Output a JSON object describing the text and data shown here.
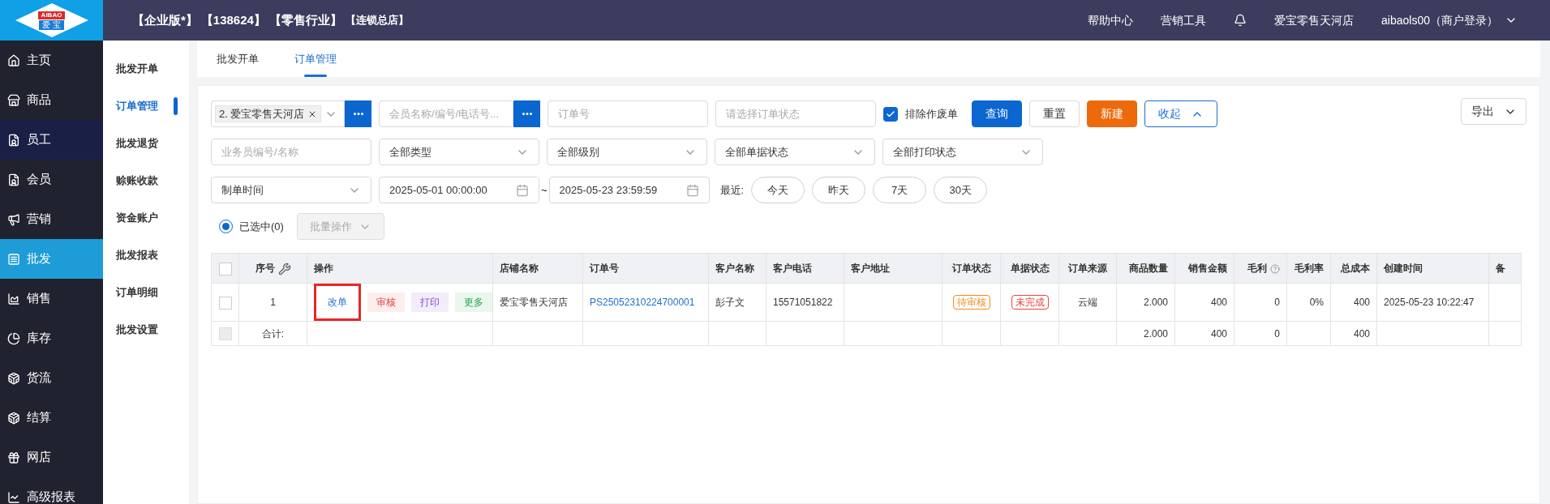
{
  "header": {
    "logo_top": "AIBAO",
    "logo_bottom": "爱 宝",
    "edition": "【企业版*】",
    "account_no": "【138624】",
    "industry": "【零售行业】",
    "store_type": "【连锁总店】",
    "links": [
      "帮助中心",
      "营销工具"
    ],
    "store": "爱宝零售天河店",
    "user": "aibaols00（商户登录）"
  },
  "sidebar": {
    "items": [
      {
        "label": "主页",
        "selected": false,
        "hovered": false
      },
      {
        "label": "商品",
        "selected": false,
        "hovered": false
      },
      {
        "label": "员工",
        "selected": false,
        "hovered": true
      },
      {
        "label": "会员",
        "selected": false,
        "hovered": false
      },
      {
        "label": "营销",
        "selected": false,
        "hovered": false
      },
      {
        "label": "批发",
        "selected": true,
        "hovered": false
      },
      {
        "label": "销售",
        "selected": false,
        "hovered": false
      },
      {
        "label": "库存",
        "selected": false,
        "hovered": false
      },
      {
        "label": "货流",
        "selected": false,
        "hovered": false
      },
      {
        "label": "结算",
        "selected": false,
        "hovered": false
      },
      {
        "label": "网店",
        "selected": false,
        "hovered": false
      },
      {
        "label": "高级报表",
        "selected": false,
        "hovered": false
      }
    ]
  },
  "submenu": {
    "items": [
      {
        "label": "批发开单",
        "selected": false
      },
      {
        "label": "订单管理",
        "selected": true
      },
      {
        "label": "批发退货",
        "selected": false
      },
      {
        "label": "赊账收款",
        "selected": false
      },
      {
        "label": "资金账户",
        "selected": false
      },
      {
        "label": "批发报表",
        "selected": false
      },
      {
        "label": "订单明细",
        "selected": false
      },
      {
        "label": "批发设置",
        "selected": false
      }
    ]
  },
  "tabs": [
    {
      "label": "批发开单",
      "selected": false
    },
    {
      "label": "订单管理",
      "selected": true
    }
  ],
  "filters": {
    "store_tag": "2. 爱宝零售天河店",
    "member_placeholder": "会员名称/编号/电话号...",
    "order_no_placeholder": "订单号",
    "order_status_placeholder": "请选择订单状态",
    "exclude_void": {
      "label": "排除作废单",
      "checked": true
    },
    "buttons": [
      {
        "label": "查询",
        "kind": "primary"
      },
      {
        "label": "重置",
        "kind": "default"
      },
      {
        "label": "新建",
        "kind": "accent"
      },
      {
        "label": "收起",
        "kind": "outline"
      }
    ],
    "export": "导出",
    "salesman_placeholder": "业务员编号/名称",
    "selects": [
      "全部类型",
      "全部级别",
      "全部单据状态",
      "全部打印状态"
    ],
    "time_type": "制单时间",
    "start": "2025-05-01 00:00:00",
    "tilde": "~",
    "end": "2025-05-23 23:59:59",
    "recent_label": "最近:",
    "recent": [
      "今天",
      "昨天",
      "7天",
      "30天"
    ],
    "selected_count": {
      "label": "已选中(0)",
      "selected": true
    },
    "batch": {
      "label": "批量操作",
      "disabled": true
    }
  },
  "table": {
    "columns": [
      {
        "label": "序号",
        "kind": "center"
      },
      {
        "label": "操作",
        "kind": "text"
      },
      {
        "label": "店铺名称",
        "kind": "text"
      },
      {
        "label": "订单号",
        "kind": "text"
      },
      {
        "label": "客户名称",
        "kind": "text"
      },
      {
        "label": "客户电话",
        "kind": "text"
      },
      {
        "label": "客户地址",
        "kind": "text"
      },
      {
        "label": "订单状态",
        "kind": "center"
      },
      {
        "label": "单据状态",
        "kind": "center"
      },
      {
        "label": "订单来源",
        "kind": "center"
      },
      {
        "label": "商品数量",
        "kind": "number"
      },
      {
        "label": "销售金额",
        "kind": "number"
      },
      {
        "label": "毛利",
        "kind": "number"
      },
      {
        "label": "毛利率",
        "kind": "number"
      },
      {
        "label": "总成本",
        "kind": "number"
      },
      {
        "label": "创建时间",
        "kind": "text"
      },
      {
        "label": "备",
        "kind": "text"
      }
    ],
    "rows": [
      {
        "checked": false,
        "cells": [
          {
            "kind": "text",
            "text": "1"
          },
          {
            "kind": "actions",
            "actions": [
              {
                "label": "改单",
                "kind": "edit",
                "highlighted": true
              },
              {
                "label": "审核",
                "kind": "audit",
                "highlighted": false
              },
              {
                "label": "打印",
                "kind": "print",
                "highlighted": false
              },
              {
                "label": "更多",
                "kind": "more",
                "highlighted": false
              }
            ]
          },
          {
            "kind": "text",
            "text": "爱宝零售天河店"
          },
          {
            "kind": "link",
            "text": "PS25052310224700001"
          },
          {
            "kind": "text",
            "text": "彭子文"
          },
          {
            "kind": "text",
            "text": "15571051822"
          },
          {
            "kind": "text",
            "text": ""
          },
          {
            "kind": "tag",
            "text": "待审核",
            "color": "#f08c1c"
          },
          {
            "kind": "tag",
            "text": "未完成",
            "color": "#e8453c"
          },
          {
            "kind": "text",
            "text": "云端"
          },
          {
            "kind": "text",
            "text": "2.000"
          },
          {
            "kind": "text",
            "text": "400"
          },
          {
            "kind": "text",
            "text": "0"
          },
          {
            "kind": "text",
            "text": "0%"
          },
          {
            "kind": "text",
            "text": "400"
          },
          {
            "kind": "text",
            "text": "2025-05-23 10:22:47"
          },
          {
            "kind": "text",
            "text": ""
          }
        ]
      }
    ],
    "select_all": {
      "checked": false
    },
    "total": {
      "label": "合计:",
      "checkbox_disabled": true,
      "cells": [
        "",
        "",
        "",
        "",
        "",
        "",
        "",
        "",
        "",
        "2.000",
        "400",
        "0",
        "",
        "400",
        "",
        ""
      ]
    }
  }
}
